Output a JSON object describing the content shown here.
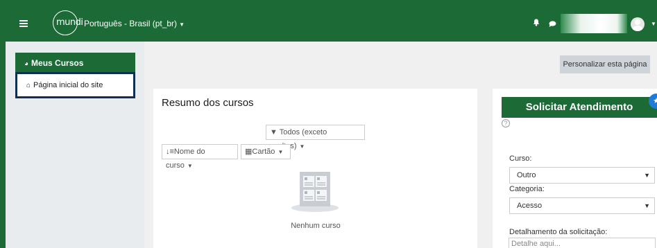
{
  "navbar": {
    "logo_text": "mundi",
    "language": "Português - Brasil (pt_br)",
    "icons": [
      "hamburger-icon",
      "bell-icon",
      "chat-icon",
      "avatar-icon"
    ]
  },
  "sidebar": {
    "header": "Meus Cursos",
    "header_icon": "dashboard-icon",
    "items": [
      {
        "label": "Página inicial do site",
        "icon": "home-icon"
      }
    ]
  },
  "page": {
    "personalize_label": "Personalizar esta página"
  },
  "courses": {
    "title": "Resumo dos cursos",
    "filter_label": "Todos (exceto ocultos)",
    "sort_label": "Nome do curso",
    "view_label": "Cartão",
    "empty_text": "Nenhum curso"
  },
  "support": {
    "button_label": "Solicitar Atendimento",
    "help_symbol": "?",
    "curso_label": "Curso:",
    "curso_value": "Outro",
    "categoria_label": "Categoria:",
    "categoria_value": "Acesso",
    "detalhe_label": "Detalhamento da solicitação:",
    "detalhe_placeholder": "Detalhe aqui..."
  },
  "colors": {
    "brand_green": "#1c6b36",
    "focus_outline": "#0e2f4f",
    "badge_blue": "#1f7bd6"
  }
}
